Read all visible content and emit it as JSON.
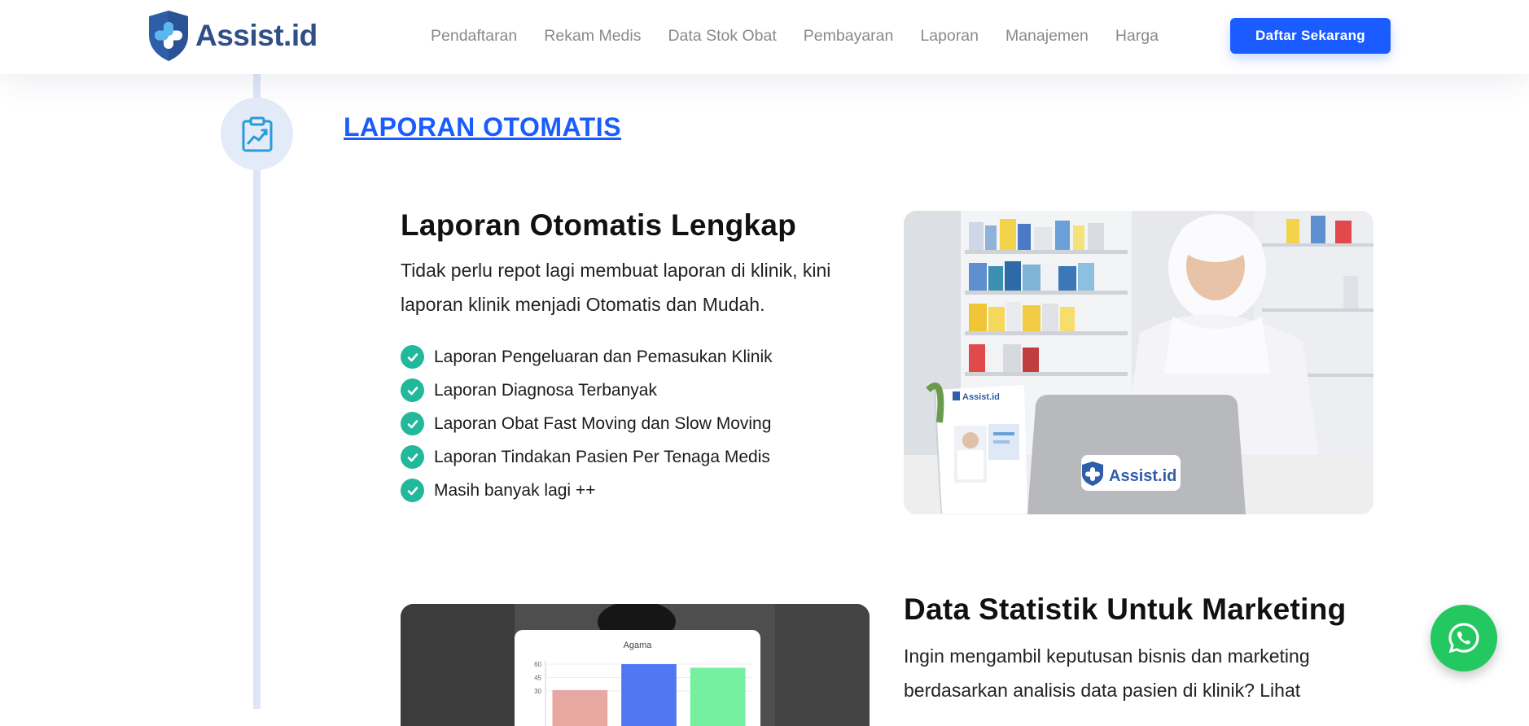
{
  "brand": {
    "name": "Assist.id",
    "accent": "#1a5cff",
    "logo_blue": "#2f4f86",
    "check_green": "#22b89a",
    "whatsapp_green": "#23c860"
  },
  "nav": {
    "items": [
      {
        "label": "Pendaftaran"
      },
      {
        "label": "Rekam Medis"
      },
      {
        "label": "Data Stok Obat"
      },
      {
        "label": "Pembayaran"
      },
      {
        "label": "Laporan"
      },
      {
        "label": "Manajemen"
      },
      {
        "label": "Harga"
      }
    ],
    "cta_label": "Daftar Sekarang"
  },
  "section": {
    "title": "LAPORAN OTOMATIS",
    "icon": "report-chart-icon"
  },
  "block1": {
    "title": "Laporan Otomatis Lengkap",
    "desc_line1": "Tidak perlu repot lagi membuat laporan di klinik, kini",
    "desc_line2": "laporan klinik menjadi Otomatis dan Mudah.",
    "features": [
      "Laporan Pengeluaran dan Pemasukan Klinik",
      "Laporan Diagnosa Terbanyak",
      "Laporan Obat Fast Moving dan Slow Moving",
      "Laporan Tindakan Pasien Per Tenaga Medis",
      "Masih banyak lagi ++"
    ],
    "photo_laptop_label": "Assist.id",
    "photo_standee_label": "Assist.id"
  },
  "block2": {
    "title": "Data Statistik Untuk Marketing",
    "desc_line1": "Ingin mengambil keputusan bisnis dan marketing",
    "desc_line2": "berdasarkan analisis data pasien di klinik? Lihat"
  },
  "chart_data": {
    "type": "bar",
    "title": "Agama",
    "categories": [
      "",
      "",
      ""
    ],
    "values": [
      31,
      60,
      56
    ],
    "colors": [
      "#e8a8a2",
      "#5078f2",
      "#74f0a0"
    ],
    "yticks": [
      30,
      45,
      60
    ],
    "ylim": [
      0,
      60
    ]
  }
}
